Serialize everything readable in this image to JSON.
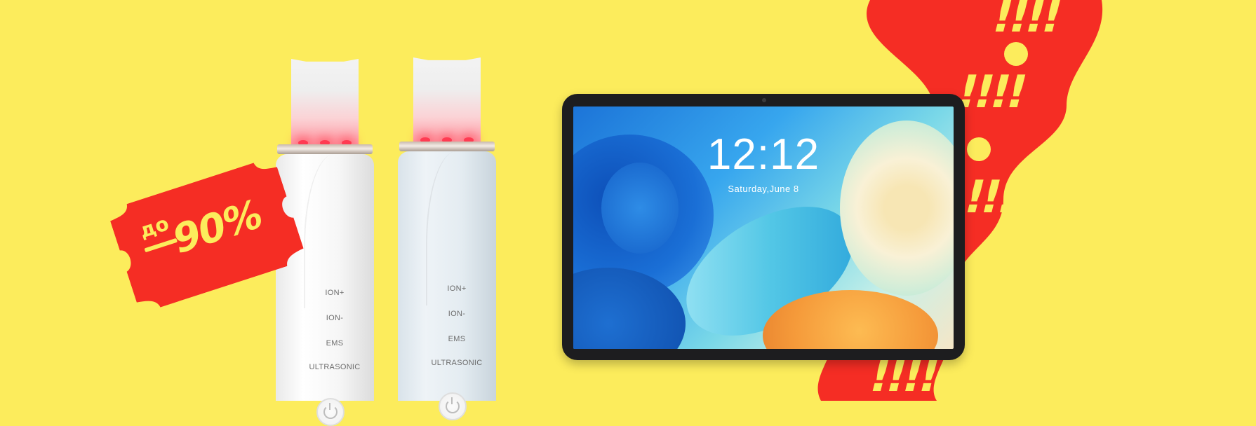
{
  "banner": {
    "background_color": "#fcec5c",
    "accent_color": "#f52d24"
  },
  "price_tag": {
    "prefix": "до",
    "value": "90%"
  },
  "ribbon": {
    "marks": [
      "!!!!",
      "!!!!",
      "!!!",
      "!!!!"
    ]
  },
  "facial_scrubbers": [
    {
      "color": "white",
      "modes": [
        "ION+",
        "ION-",
        "EMS",
        "ULTRASONIC"
      ],
      "button_icon": "power-icon"
    },
    {
      "color": "light-blue",
      "modes": [
        "ION+",
        "ION-",
        "EMS",
        "ULTRASONIC"
      ],
      "button_icon": "power-icon"
    }
  ],
  "tablet": {
    "time": "12:12",
    "date": "Saturday,June 8"
  }
}
